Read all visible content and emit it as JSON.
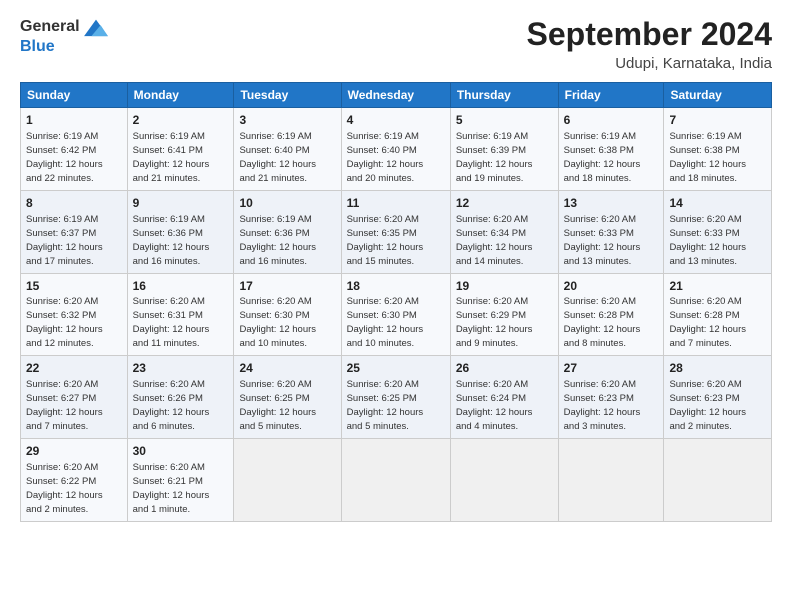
{
  "header": {
    "logo_general": "General",
    "logo_blue": "Blue",
    "month": "September 2024",
    "location": "Udupi, Karnataka, India"
  },
  "columns": [
    "Sunday",
    "Monday",
    "Tuesday",
    "Wednesday",
    "Thursday",
    "Friday",
    "Saturday"
  ],
  "weeks": [
    [
      {
        "day": "1",
        "info": "Sunrise: 6:19 AM\nSunset: 6:42 PM\nDaylight: 12 hours\nand 22 minutes."
      },
      {
        "day": "2",
        "info": "Sunrise: 6:19 AM\nSunset: 6:41 PM\nDaylight: 12 hours\nand 21 minutes."
      },
      {
        "day": "3",
        "info": "Sunrise: 6:19 AM\nSunset: 6:40 PM\nDaylight: 12 hours\nand 21 minutes."
      },
      {
        "day": "4",
        "info": "Sunrise: 6:19 AM\nSunset: 6:40 PM\nDaylight: 12 hours\nand 20 minutes."
      },
      {
        "day": "5",
        "info": "Sunrise: 6:19 AM\nSunset: 6:39 PM\nDaylight: 12 hours\nand 19 minutes."
      },
      {
        "day": "6",
        "info": "Sunrise: 6:19 AM\nSunset: 6:38 PM\nDaylight: 12 hours\nand 18 minutes."
      },
      {
        "day": "7",
        "info": "Sunrise: 6:19 AM\nSunset: 6:38 PM\nDaylight: 12 hours\nand 18 minutes."
      }
    ],
    [
      {
        "day": "8",
        "info": "Sunrise: 6:19 AM\nSunset: 6:37 PM\nDaylight: 12 hours\nand 17 minutes."
      },
      {
        "day": "9",
        "info": "Sunrise: 6:19 AM\nSunset: 6:36 PM\nDaylight: 12 hours\nand 16 minutes."
      },
      {
        "day": "10",
        "info": "Sunrise: 6:19 AM\nSunset: 6:36 PM\nDaylight: 12 hours\nand 16 minutes."
      },
      {
        "day": "11",
        "info": "Sunrise: 6:20 AM\nSunset: 6:35 PM\nDaylight: 12 hours\nand 15 minutes."
      },
      {
        "day": "12",
        "info": "Sunrise: 6:20 AM\nSunset: 6:34 PM\nDaylight: 12 hours\nand 14 minutes."
      },
      {
        "day": "13",
        "info": "Sunrise: 6:20 AM\nSunset: 6:33 PM\nDaylight: 12 hours\nand 13 minutes."
      },
      {
        "day": "14",
        "info": "Sunrise: 6:20 AM\nSunset: 6:33 PM\nDaylight: 12 hours\nand 13 minutes."
      }
    ],
    [
      {
        "day": "15",
        "info": "Sunrise: 6:20 AM\nSunset: 6:32 PM\nDaylight: 12 hours\nand 12 minutes."
      },
      {
        "day": "16",
        "info": "Sunrise: 6:20 AM\nSunset: 6:31 PM\nDaylight: 12 hours\nand 11 minutes."
      },
      {
        "day": "17",
        "info": "Sunrise: 6:20 AM\nSunset: 6:30 PM\nDaylight: 12 hours\nand 10 minutes."
      },
      {
        "day": "18",
        "info": "Sunrise: 6:20 AM\nSunset: 6:30 PM\nDaylight: 12 hours\nand 10 minutes."
      },
      {
        "day": "19",
        "info": "Sunrise: 6:20 AM\nSunset: 6:29 PM\nDaylight: 12 hours\nand 9 minutes."
      },
      {
        "day": "20",
        "info": "Sunrise: 6:20 AM\nSunset: 6:28 PM\nDaylight: 12 hours\nand 8 minutes."
      },
      {
        "day": "21",
        "info": "Sunrise: 6:20 AM\nSunset: 6:28 PM\nDaylight: 12 hours\nand 7 minutes."
      }
    ],
    [
      {
        "day": "22",
        "info": "Sunrise: 6:20 AM\nSunset: 6:27 PM\nDaylight: 12 hours\nand 7 minutes."
      },
      {
        "day": "23",
        "info": "Sunrise: 6:20 AM\nSunset: 6:26 PM\nDaylight: 12 hours\nand 6 minutes."
      },
      {
        "day": "24",
        "info": "Sunrise: 6:20 AM\nSunset: 6:25 PM\nDaylight: 12 hours\nand 5 minutes."
      },
      {
        "day": "25",
        "info": "Sunrise: 6:20 AM\nSunset: 6:25 PM\nDaylight: 12 hours\nand 5 minutes."
      },
      {
        "day": "26",
        "info": "Sunrise: 6:20 AM\nSunset: 6:24 PM\nDaylight: 12 hours\nand 4 minutes."
      },
      {
        "day": "27",
        "info": "Sunrise: 6:20 AM\nSunset: 6:23 PM\nDaylight: 12 hours\nand 3 minutes."
      },
      {
        "day": "28",
        "info": "Sunrise: 6:20 AM\nSunset: 6:23 PM\nDaylight: 12 hours\nand 2 minutes."
      }
    ],
    [
      {
        "day": "29",
        "info": "Sunrise: 6:20 AM\nSunset: 6:22 PM\nDaylight: 12 hours\nand 2 minutes."
      },
      {
        "day": "30",
        "info": "Sunrise: 6:20 AM\nSunset: 6:21 PM\nDaylight: 12 hours\nand 1 minute."
      },
      {
        "day": "",
        "info": ""
      },
      {
        "day": "",
        "info": ""
      },
      {
        "day": "",
        "info": ""
      },
      {
        "day": "",
        "info": ""
      },
      {
        "day": "",
        "info": ""
      }
    ]
  ]
}
